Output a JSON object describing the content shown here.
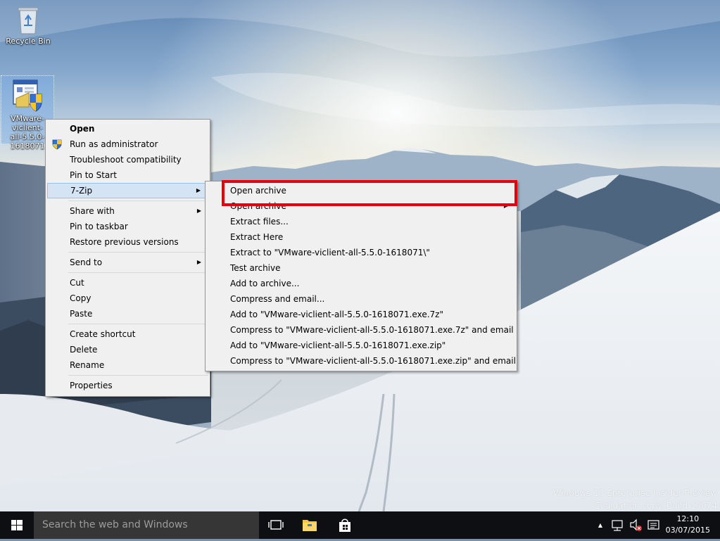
{
  "desktop": {
    "icons": [
      {
        "label": "Recycle Bin"
      },
      {
        "label_lines": [
          "VMware-viclient-",
          "all-5.5.0-",
          "1618071"
        ]
      }
    ]
  },
  "context_menu": {
    "items": [
      {
        "label": "Open",
        "bold": true
      },
      {
        "label": "Run as administrator",
        "icon": "shield-icon"
      },
      {
        "label": "Troubleshoot compatibility"
      },
      {
        "label": "Pin to Start"
      },
      {
        "label": "7-Zip",
        "submenu": true,
        "highlighted": true
      },
      {
        "label": "Share with",
        "submenu": true
      },
      {
        "label": "Pin to taskbar"
      },
      {
        "label": "Restore previous versions"
      },
      {
        "label": "Send to",
        "submenu": true
      },
      {
        "label": "Cut"
      },
      {
        "label": "Copy"
      },
      {
        "label": "Paste"
      },
      {
        "label": "Create shortcut"
      },
      {
        "label": "Delete"
      },
      {
        "label": "Rename"
      },
      {
        "label": "Properties"
      }
    ]
  },
  "sevenzip_menu": {
    "items": [
      {
        "label": "Open archive"
      },
      {
        "label": "Open archive",
        "submenu": true
      },
      {
        "label": "Extract files..."
      },
      {
        "label": "Extract Here"
      },
      {
        "label": "Extract to \"VMware-viclient-all-5.5.0-1618071\\\""
      },
      {
        "label": "Test archive"
      },
      {
        "label": "Add to archive..."
      },
      {
        "label": "Compress and email..."
      },
      {
        "label": "Add to \"VMware-viclient-all-5.5.0-1618071.exe.7z\""
      },
      {
        "label": "Compress to \"VMware-viclient-all-5.5.0-1618071.exe.7z\" and email"
      },
      {
        "label": "Add to \"VMware-viclient-all-5.5.0-1618071.exe.zip\""
      },
      {
        "label": "Compress to \"VMware-viclient-all-5.5.0-1618071.exe.zip\" and email"
      }
    ]
  },
  "watermark": {
    "line1": "Windows 10 Enterprise Insider Preview",
    "line2": "Evaluation copy. Build 10074"
  },
  "taskbar": {
    "search_placeholder": "Search the web and Windows",
    "time": "12:10",
    "date": "03/07/2015",
    "tray_arrow": "▲"
  },
  "colors": {
    "highlight_bg": "#d5e4f5",
    "annotation_box": "#e5000b",
    "taskbar_bg": "#0e0f12"
  }
}
